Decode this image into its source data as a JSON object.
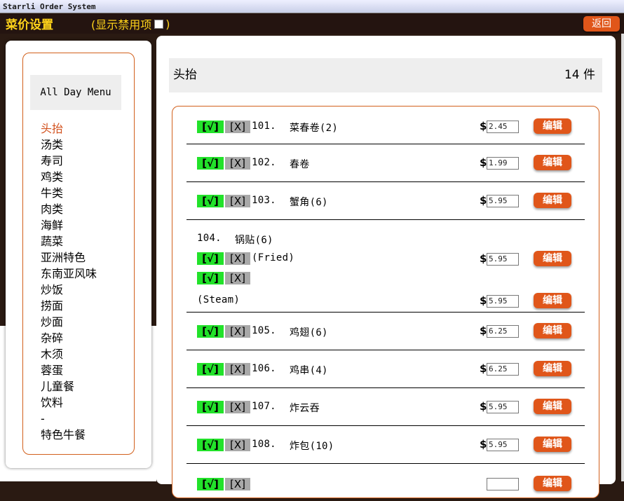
{
  "window": {
    "title": "Starrli Order System"
  },
  "header": {
    "title": "菜价设置",
    "show_disabled_label": "(显示禁用项",
    "show_disabled_close": ")",
    "back_label": "返回"
  },
  "sidebar": {
    "menu_name": "All Day Menu",
    "categories": [
      "头抬",
      "汤类",
      "寿司",
      "鸡类",
      "牛类",
      "肉类",
      "海鲜",
      "蔬菜",
      "亚洲特色",
      "东南亚风味",
      "炒饭",
      "捞面",
      "炒面",
      "杂碎",
      "木须",
      "蓉蛋",
      "儿童餐",
      "饮料",
      "-",
      "特色牛餐"
    ],
    "active_category": "头抬"
  },
  "section": {
    "title": "头抬",
    "count": "14 件"
  },
  "controls": {
    "enable_label": "[√]",
    "disable_label": "[X]",
    "currency": "$",
    "edit_label": "编辑"
  },
  "items": [
    {
      "code": "101.",
      "name": "菜春卷(2)",
      "price": "2.45"
    },
    {
      "code": "102.",
      "name": "春卷",
      "price": "1.99"
    },
    {
      "code": "103.",
      "name": "蟹角(6)",
      "price": "5.95"
    },
    {
      "code": "104.",
      "name": "锅贴(6)",
      "variants": [
        {
          "label": "(Fried)",
          "price": "5.95"
        },
        {
          "label": "(Steam)",
          "price": "5.95"
        }
      ]
    },
    {
      "code": "105.",
      "name": "鸡翅(6)",
      "price": "6.25"
    },
    {
      "code": "106.",
      "name": "鸡串(4)",
      "price": "6.25"
    },
    {
      "code": "107.",
      "name": "炸云吞",
      "price": "5.95"
    },
    {
      "code": "108.",
      "name": "炸包(10)",
      "price": "5.95"
    }
  ]
}
